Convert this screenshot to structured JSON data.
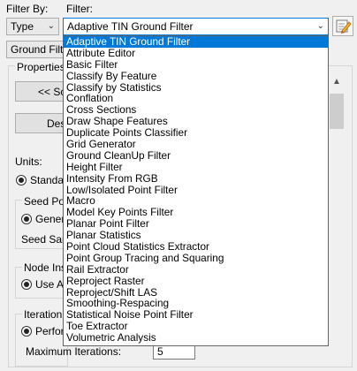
{
  "filter_by": {
    "label": "Filter By:",
    "value": "Type"
  },
  "filter": {
    "label": "Filter:",
    "value": "Adaptive TIN Ground Filter"
  },
  "secondary_combo": {
    "value": "Ground Filte"
  },
  "properties_group": {
    "label": "Properties"
  },
  "buttons": {
    "prev_label": "<< Sc",
    "des_label": "Des"
  },
  "units": {
    "label": "Units:",
    "standard_label": "Standar"
  },
  "seed": {
    "point_label": "Seed Poi",
    "general_label": "Genera",
    "sample_label": "Seed Sam"
  },
  "node": {
    "label": "Node Ins",
    "use_label": "Use Au"
  },
  "iteration": {
    "label": "Iteration",
    "perform_label": "Perfor",
    "max_label": "Maximum Iterations:",
    "max_value": "5"
  },
  "dropdown_items": [
    "Adaptive TIN Ground Filter",
    "Attribute Editor",
    "Basic Filter",
    "Classify By Feature",
    "Classify by Statistics",
    "Conflation",
    "Cross Sections",
    "Draw Shape Features",
    "Duplicate Points Classifier",
    "Grid Generator",
    "Ground CleanUp Filter",
    "Height Filter",
    "Intensity From RGB",
    "Low/Isolated Point Filter",
    "Macro",
    "Model Key Points Filter",
    "Planar Point Filter",
    "Planar Statistics",
    "Point Cloud Statistics Extractor",
    "Point Group Tracing and Squaring",
    "Rail Extractor",
    "Reproject Raster",
    "Reproject/Shift LAS",
    "Smoothing-Respacing",
    "Statistical Noise Point Filter",
    "Toe Extractor",
    "Volumetric Analysis"
  ],
  "selected_index": 0,
  "icons": {
    "settings_button": "edit-settings-icon",
    "dropdown_arrow": "chevron-down-icon"
  }
}
